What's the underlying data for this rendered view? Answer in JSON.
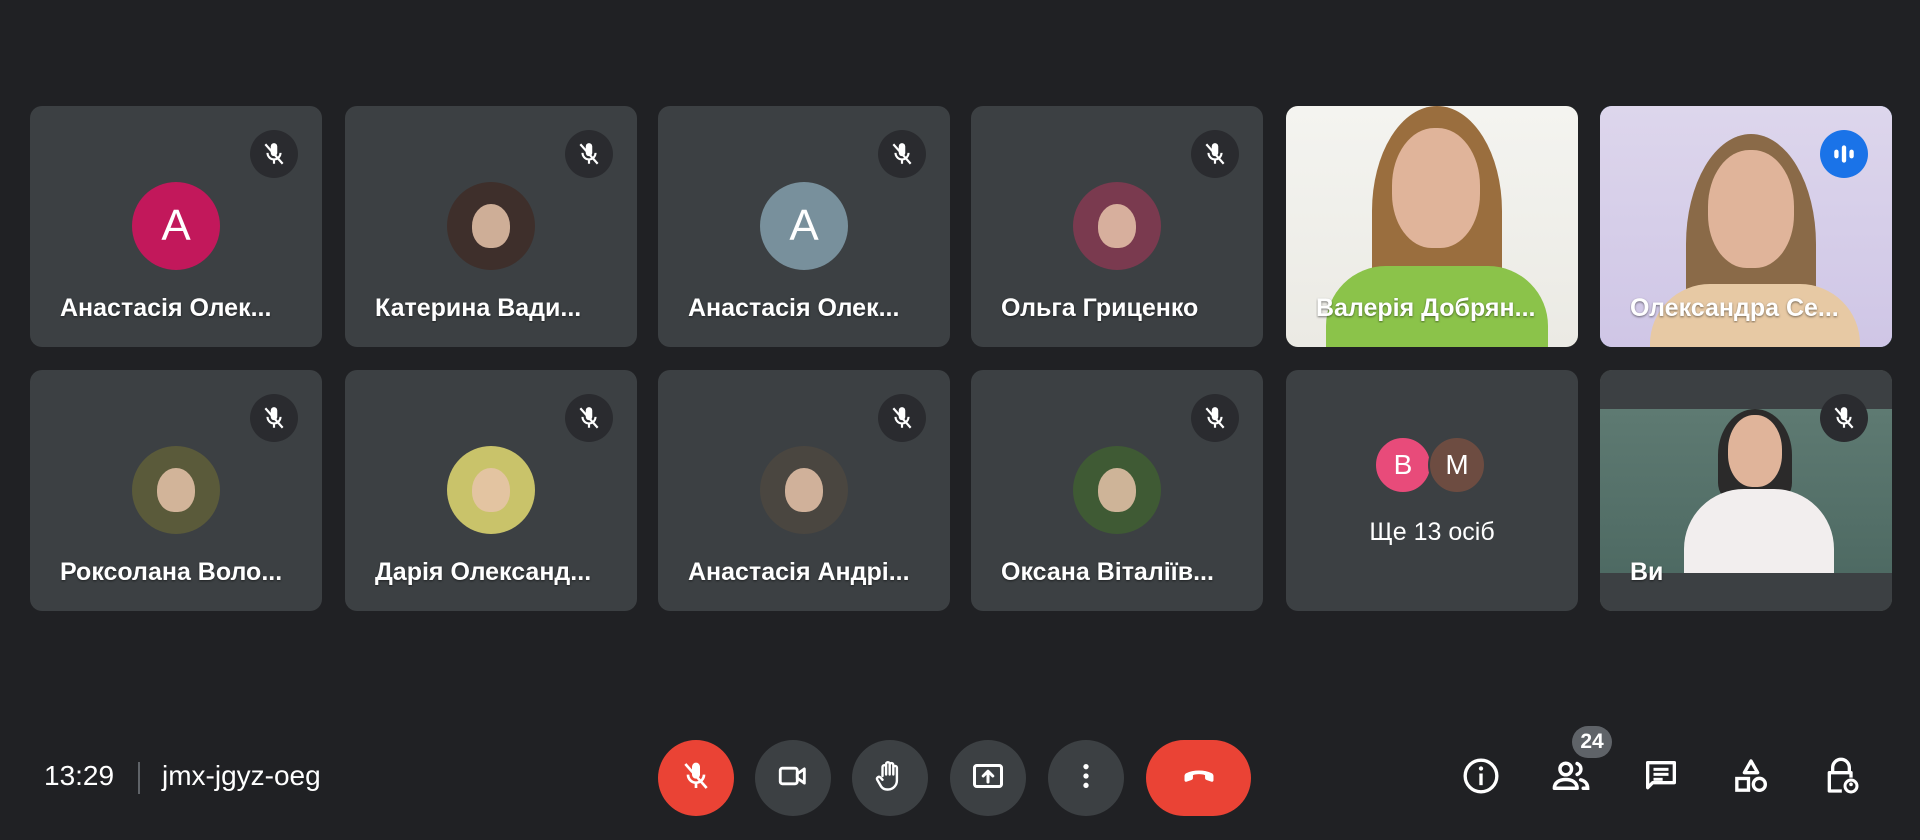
{
  "tiles": [
    {
      "name": "Анастасія Олек...",
      "initial": "А",
      "kind": "initial",
      "color": "#c2185b",
      "muted": true
    },
    {
      "name": "Катерина Вади...",
      "kind": "photo",
      "color": "#3e2f2b",
      "muted": true
    },
    {
      "name": "Анастасія Олек...",
      "initial": "А",
      "kind": "initial",
      "color": "#78909c",
      "muted": true
    },
    {
      "name": "Ольга Гриценко",
      "kind": "photo",
      "color": "#7a3a4f",
      "muted": true
    },
    {
      "name": "Валерія Добрян...",
      "kind": "video",
      "muted": false
    },
    {
      "name": "Олександра Се...",
      "kind": "video",
      "muted": false,
      "speaking": true
    },
    {
      "name": "Роксолана Воло...",
      "kind": "photo",
      "color": "#5a5a3a",
      "muted": true
    },
    {
      "name": "Дарія Олександ...",
      "kind": "photo",
      "color": "#c9c36a",
      "muted": true
    },
    {
      "name": "Анастасія Андрі...",
      "kind": "photo",
      "color": "#4a4640",
      "muted": true
    },
    {
      "name": "Оксана Віталіїв...",
      "kind": "photo",
      "color": "#3f5a34",
      "muted": true
    },
    {
      "kind": "more",
      "more_text": "Ще 13 осіб",
      "mini": [
        {
          "initial": "В",
          "color": "#e84b7a"
        },
        {
          "initial": "М",
          "color": "#6d4c41"
        }
      ]
    },
    {
      "name": "Ви",
      "kind": "video",
      "muted": true
    }
  ],
  "bottom_bar": {
    "time": "13:29",
    "meeting_code": "jmx-jgyz-oeg",
    "participant_count": "24"
  },
  "icons": {
    "mic_off": "mic-off-icon",
    "camera": "camera-icon",
    "hand": "raise-hand-icon",
    "present": "present-screen-icon",
    "more": "more-options-icon",
    "end_call": "end-call-icon",
    "info": "info-icon",
    "people": "people-icon",
    "chat": "chat-icon",
    "activities": "activities-icon",
    "host": "host-controls-icon"
  },
  "colors": {
    "background": "#202124",
    "tile": "#3c4043",
    "danger": "#ea4335",
    "speaking_border": "#8ab4f8",
    "speaking_badge": "#1a73e8"
  }
}
